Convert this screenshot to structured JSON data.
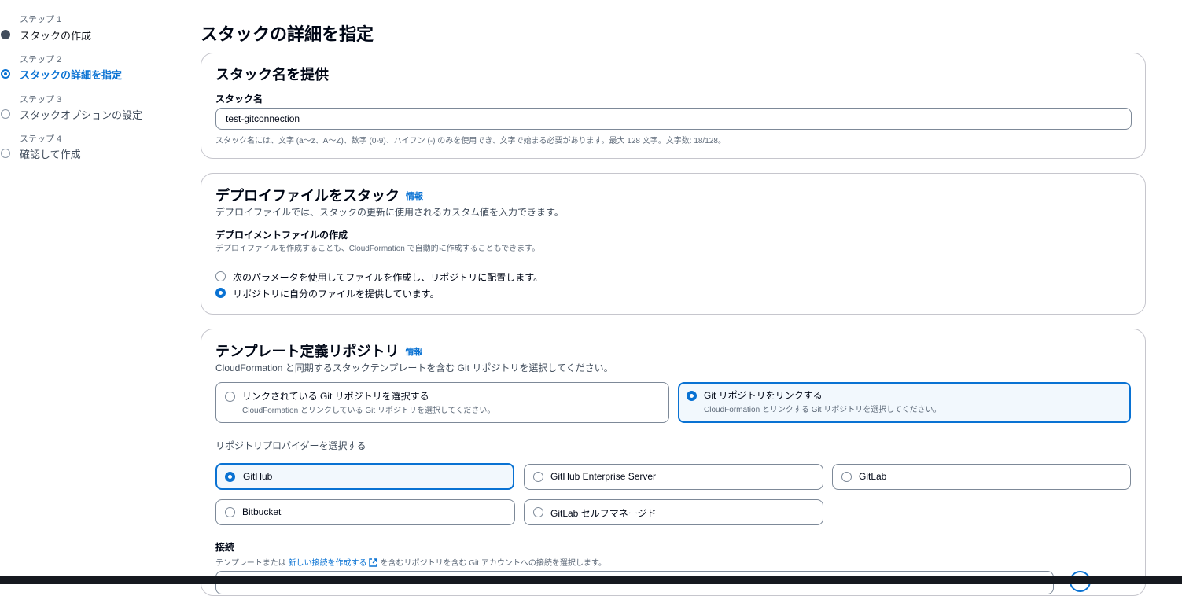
{
  "steps": [
    {
      "num": "ステップ 1",
      "label": "スタックの作成",
      "state": "done"
    },
    {
      "num": "ステップ 2",
      "label": "スタックの詳細を指定",
      "state": "active"
    },
    {
      "num": "ステップ 3",
      "label": "スタックオプションの設定",
      "state": "todo"
    },
    {
      "num": "ステップ 4",
      "label": "確認して作成",
      "state": "todo"
    }
  ],
  "page_title": "スタックの詳細を指定",
  "stack_name": {
    "title": "スタック名を提供",
    "label": "スタック名",
    "value": "test-gitconnection",
    "hint": "スタック名には、文字 (a～z、A～Z)、数字 (0-9)、ハイフン (-) のみを使用でき、文字で始まる必要があります。最大 128 文字。文字数:   18/128。"
  },
  "deploy_file": {
    "title": "デプロイファイルをスタック",
    "info": "情報",
    "description": "デプロイファイルでは、スタックの更新に使用されるカスタム値を入力できます。",
    "field_label": "デプロイメントファイルの作成",
    "field_hint": "デプロイファイルを作成することも、CloudFormation で自動的に作成することもできます。",
    "options": [
      {
        "label": "次のパラメータを使用してファイルを作成し、リポジトリに配置します。",
        "selected": false
      },
      {
        "label": "リポジトリに自分のファイルを提供しています。",
        "selected": true
      }
    ]
  },
  "template_repo": {
    "title": "テンプレート定義リポジトリ",
    "info": "情報",
    "description": "CloudFormation と同期するスタックテンプレートを含む Git リポジトリを選択してください。",
    "tiles": [
      {
        "label": "リンクされている Git リポジトリを選択する",
        "sub": "CloudFormation とリンクしている Git リポジトリを選択してください。",
        "selected": false
      },
      {
        "label": "Git リポジトリをリンクする",
        "sub": "CloudFormation とリンクする Git リポジトリを選択してください。",
        "selected": true
      }
    ],
    "provider_label": "リポジトリプロバイダーを選択する",
    "providers": [
      {
        "label": "GitHub",
        "selected": true
      },
      {
        "label": "GitHub Enterprise Server",
        "selected": false
      },
      {
        "label": "GitLab",
        "selected": false
      },
      {
        "label": "Bitbucket",
        "selected": false
      },
      {
        "label": "GitLab セルフマネージド",
        "selected": false
      }
    ],
    "connection": {
      "label": "接続",
      "hint_before": "テンプレートまたは",
      "hint_link": "新しい接続を作成する",
      "hint_after": "を含むリポジトリを含む Git アカウントへの接続を選択します。"
    }
  },
  "colors": {
    "accent": "#0972d3",
    "border": "#c6c6cd",
    "selected_bg": "#f2f8fd"
  }
}
